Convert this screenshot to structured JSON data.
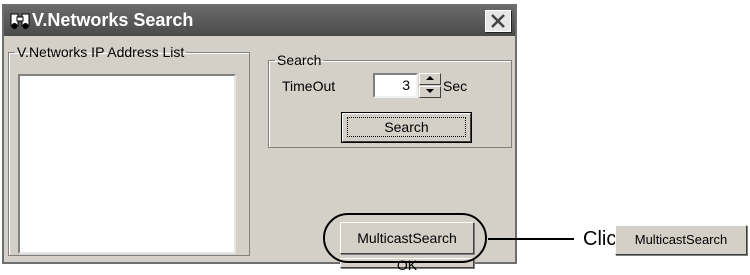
{
  "window": {
    "title": "V.Networks Search",
    "icon": "binoculars-icon",
    "close_icon": "close-icon"
  },
  "ip_list_group": {
    "legend": "V.Networks IP Address List",
    "items": []
  },
  "search_group": {
    "legend": "Search",
    "timeout_label": "TimeOut",
    "timeout_value": "3",
    "unit_label": "Sec",
    "search_button": "Search"
  },
  "buttons": {
    "multicast_search": "MulticastSearch",
    "ok": "OK"
  },
  "callout": {
    "instruction": "Click",
    "button_label": "MulticastSearch"
  }
}
